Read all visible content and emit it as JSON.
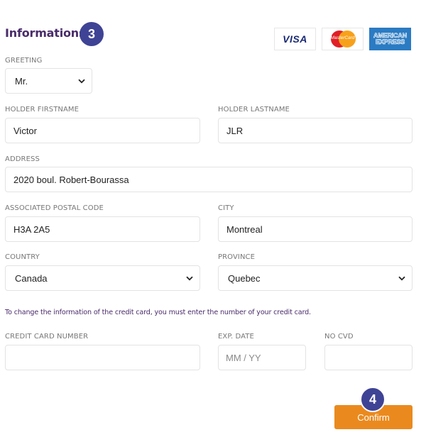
{
  "header": {
    "title": "Informations",
    "step": "3"
  },
  "payment_cards": [
    {
      "name": "visa-logo",
      "label": "VISA"
    },
    {
      "name": "mastercard-logo",
      "label": "MasterCard"
    },
    {
      "name": "amex-logo",
      "lines": [
        "AMERICAN",
        "EXPRESS"
      ]
    }
  ],
  "form": {
    "greeting": {
      "label": "GREETING",
      "value": "Mr."
    },
    "firstname": {
      "label": "HOLDER FIRSTNAME",
      "value": "Victor"
    },
    "lastname": {
      "label": "HOLDER LASTNAME",
      "value": "JLR"
    },
    "address": {
      "label": "ADDRESS",
      "value": "2020 boul. Robert-Bourassa"
    },
    "postal_code": {
      "label": "ASSOCIATED POSTAL CODE",
      "value": "H3A 2A5"
    },
    "city": {
      "label": "CITY",
      "value": "Montreal"
    },
    "country": {
      "label": "COUNTRY",
      "value": "Canada"
    },
    "province": {
      "label": "PROVINCE",
      "value": "Quebec"
    },
    "note": "To change the information of the credit card, you must enter the number of your credit card.",
    "card_number": {
      "label": "CREDIT CARD NUMBER",
      "value": "",
      "placeholder": ""
    },
    "exp_date": {
      "label": "EXP. DATE",
      "value": "",
      "placeholder": "MM / YY"
    },
    "cvd": {
      "label": "NO CVD",
      "value": "",
      "placeholder": ""
    }
  },
  "footer": {
    "step": "4",
    "confirm_label": "Confirm"
  },
  "colors": {
    "title": "#4a2c6b",
    "step_badge": "#3f4395",
    "confirm_button": "#ea8a1e"
  }
}
